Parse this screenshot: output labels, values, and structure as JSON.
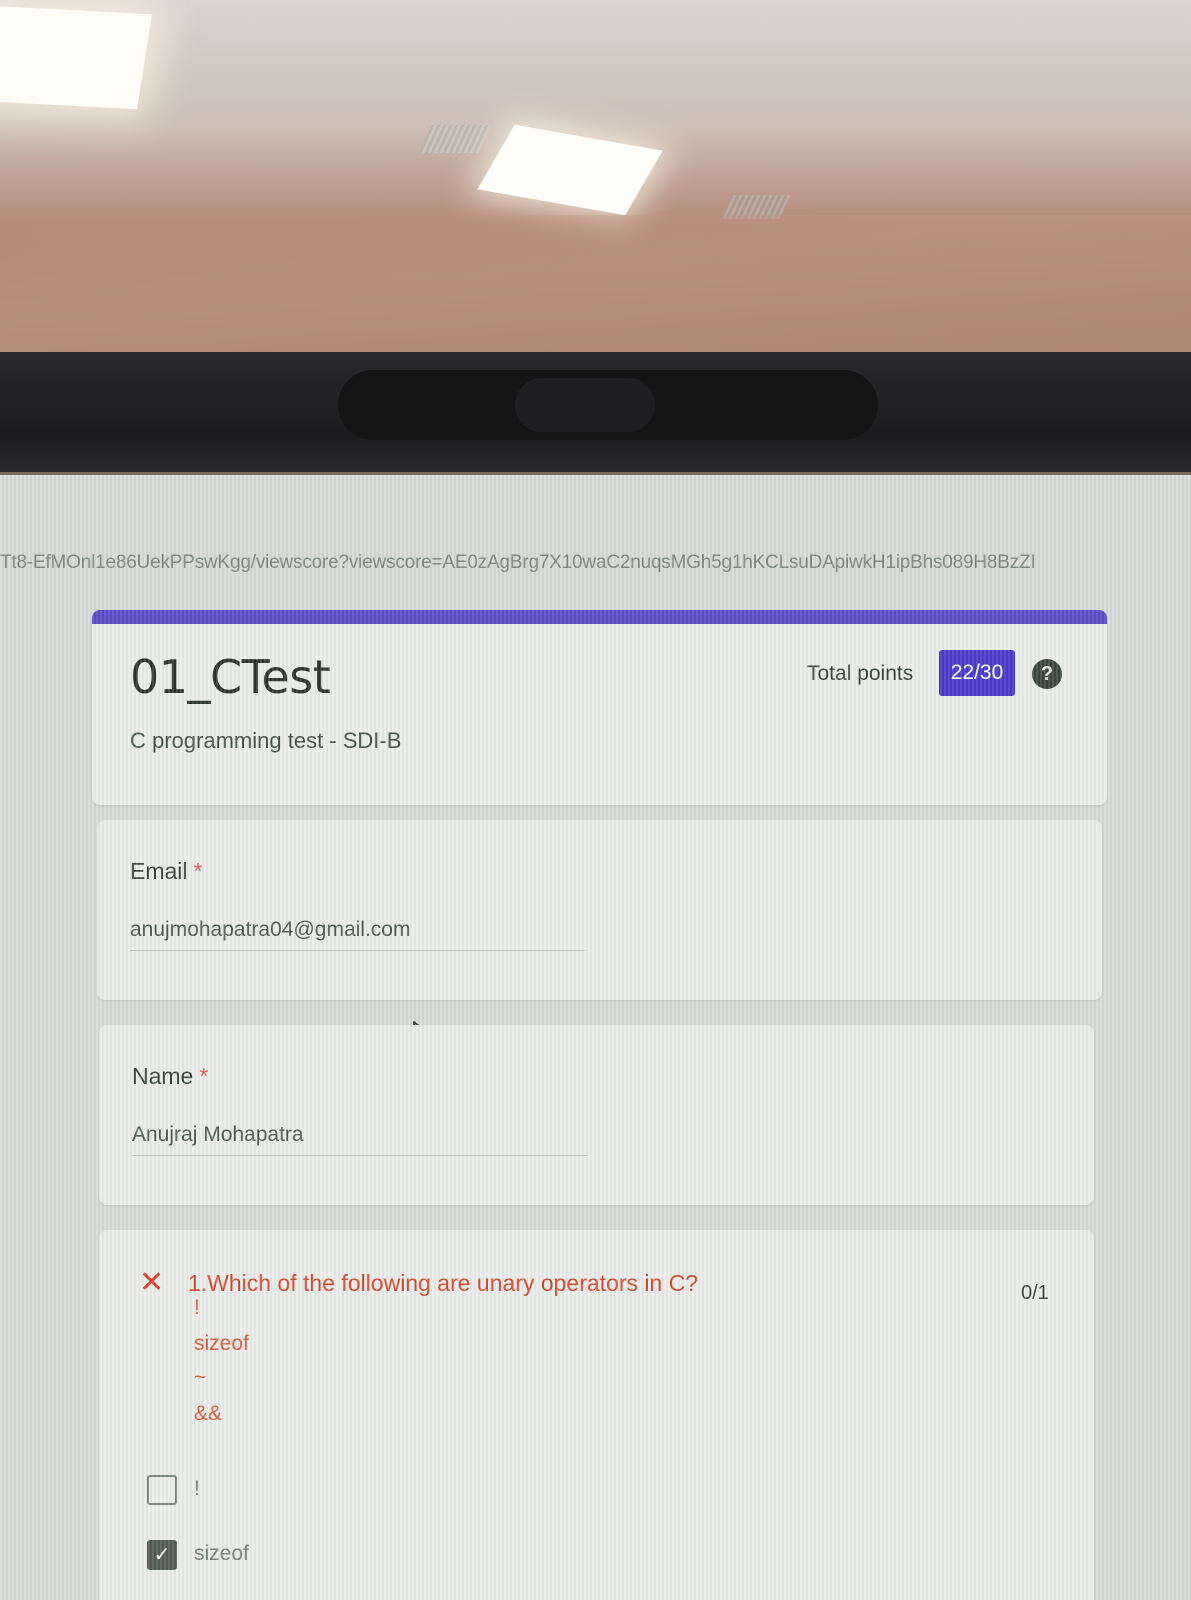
{
  "browser": {
    "url": "Tt8-EfMOnl1e86UekPPswKgg/viewscore?viewscore=AE0zAgBrg7X10waC2nuqsMGh5g1hKCLsuDApiwkH1ipBhs089H8BzZI"
  },
  "form": {
    "title": "01_CTest",
    "description": "C programming test - SDI-B",
    "total_points_label": "Total points",
    "total_points_value": "22/30",
    "help_icon": "?"
  },
  "fields": {
    "email": {
      "label": "Email",
      "required_mark": "*",
      "value": "anujmohapatra04@gmail.com"
    },
    "name": {
      "label": "Name",
      "required_mark": "*",
      "value": "Anujraj Mohapatra"
    }
  },
  "question_1": {
    "status_icon": "✕",
    "title": "1.Which of the following are unary operators in C?",
    "score": "0/1",
    "option_lines": [
      "!",
      "sizeof",
      "~",
      "&&"
    ],
    "choices": [
      {
        "label": "!",
        "checked": false
      },
      {
        "label": "sizeof",
        "checked": true
      }
    ]
  },
  "icons": {
    "help": "help-circle-icon",
    "wrong": "close-icon",
    "cursor": "mouse-pointer-icon"
  },
  "colors": {
    "accent": "#5a4bc6",
    "badge": "#4b39c7",
    "error": "#d93a2b"
  }
}
